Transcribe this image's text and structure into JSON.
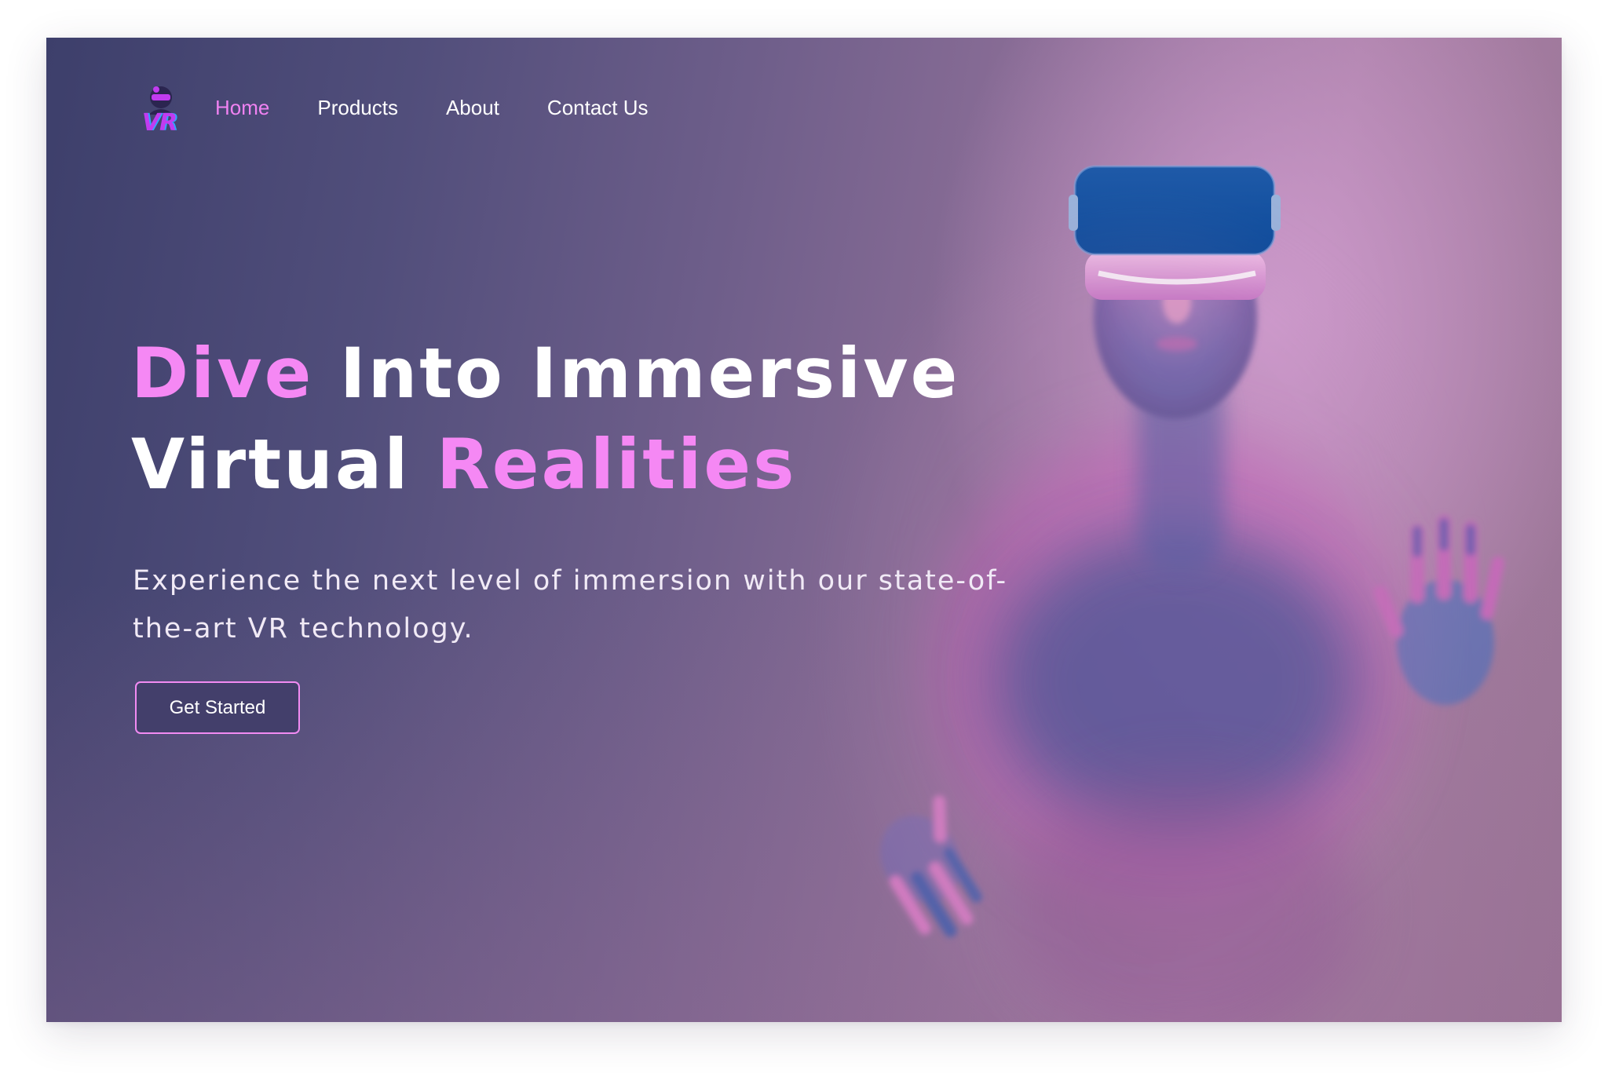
{
  "brand": {
    "logo_text": "VR",
    "colors": {
      "accent_pink": "#f588f4",
      "nav_active": "#f082f2",
      "button_bg": "#433f6b",
      "button_border": "#f28bf3"
    }
  },
  "nav": {
    "items": [
      {
        "label": "Home",
        "active": true
      },
      {
        "label": "Products",
        "active": false
      },
      {
        "label": "About",
        "active": false
      },
      {
        "label": "Contact Us",
        "active": false
      }
    ]
  },
  "hero": {
    "headline": {
      "line1_highlight": "Dive",
      "line1_rest": " Into Immersive",
      "line2_rest": "Virtual ",
      "line2_highlight": "Realities"
    },
    "subtitle": "Experience the next level of immersion with our state-of-the-art VR technology.",
    "cta_label": "Get Started"
  },
  "image": {
    "subject": "person-wearing-vr-headset-behind-frosted-glass",
    "icon": "vr-headset-figure"
  }
}
